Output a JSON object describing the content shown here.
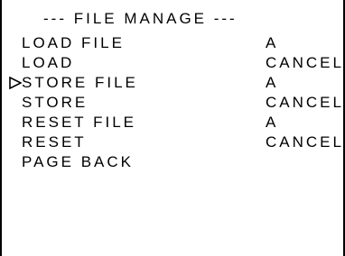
{
  "menu": {
    "title": "--- FILE MANAGE ---",
    "cursor_icon": "triangle-right-outline-icon",
    "selected_index": 2,
    "items": [
      {
        "label": "LOAD FILE",
        "value": "A"
      },
      {
        "label": "LOAD",
        "value": "CANCEL"
      },
      {
        "label": "STORE FILE",
        "value": "A"
      },
      {
        "label": "STORE",
        "value": "CANCEL"
      },
      {
        "label": "RESET FILE",
        "value": "A"
      },
      {
        "label": "RESET",
        "value": "CANCEL"
      },
      {
        "label": "PAGE BACK",
        "value": ""
      }
    ]
  }
}
